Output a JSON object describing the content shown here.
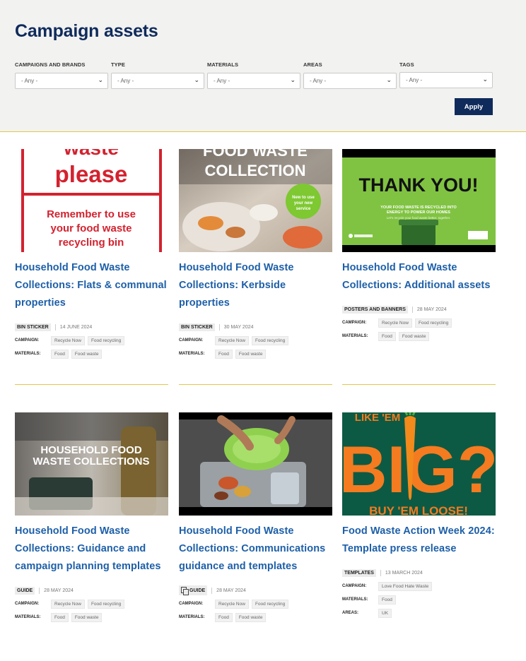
{
  "page": {
    "title": "Campaign assets"
  },
  "filters": [
    {
      "label": "Campaigns and brands",
      "value": "- Any -"
    },
    {
      "label": "Type",
      "value": "- Any -"
    },
    {
      "label": "Materials",
      "value": "- Any -"
    },
    {
      "label": "Areas",
      "value": "- Any -"
    },
    {
      "label": "Tags",
      "value": "- Any -"
    }
  ],
  "apply_label": "Apply",
  "colors": {
    "navy": "#0f2b5b",
    "link_blue": "#1d5fa8",
    "accent_yellow": "#e2c84a",
    "panel_grey": "#f2f2f1"
  },
  "cards": [
    {
      "title": "Household Food Waste Collections: Flats & communal properties",
      "type": "Bin sticker",
      "date": "14 June 2024",
      "campaign_label": "Campaign:",
      "materials_label": "Materials:",
      "campaign": [
        "Recycle Now",
        "Food recycling"
      ],
      "materials": [
        "Food",
        "Food waste"
      ],
      "image": {
        "line1": "waste",
        "line2": "please",
        "line3": "Remember to use",
        "line4": "your food waste",
        "line5": "recycling bin"
      }
    },
    {
      "title": "Household Food Waste Collections: Kerbside properties",
      "type": "Bin sticker",
      "date": "30 May 2024",
      "campaign_label": "Campaign:",
      "materials_label": "Materials:",
      "campaign": [
        "Recycle Now",
        "Food recycling"
      ],
      "materials": [
        "Food",
        "Food waste"
      ],
      "image": {
        "line1": "FOOD WASTE",
        "line2": "COLLECTION",
        "badge": "New to use your new service"
      }
    },
    {
      "title": "Household Food Waste Collections: Additional assets",
      "type": "Posters and banners",
      "date": "28 May 2024",
      "campaign_label": "Campaign:",
      "materials_label": "Materials:",
      "campaign": [
        "Recycle Now",
        "Food recycling"
      ],
      "materials": [
        "Food",
        "Food waste"
      ],
      "image": {
        "headline": "THANK YOU!",
        "sub1": "YOUR FOOD WASTE IS RECYCLED INTO",
        "sub2": "ENERGY TO POWER OUR HOMES",
        "sub3": "Let's recycle your food waste better, together."
      }
    },
    {
      "title": "Household Food Waste Collections: Guidance and campaign planning templates",
      "type": "Guide",
      "date": "28 May 2024",
      "campaign_label": "Campaign:",
      "materials_label": "Materials:",
      "campaign": [
        "Recycle Now",
        "Food recycling"
      ],
      "materials": [
        "Food",
        "Food waste"
      ],
      "image": {
        "line1": "HOUSEHOLD FOOD",
        "line2": "WASTE COLLECTIONS"
      }
    },
    {
      "title": "Household Food Waste Collections: Communications guidance and templates",
      "type": "Guide",
      "date": "28 May 2024",
      "campaign_label": "Campaign:",
      "materials_label": "Materials:",
      "campaign": [
        "Recycle Now",
        "Food recycling"
      ],
      "materials": [
        "Food",
        "Food waste"
      ]
    },
    {
      "title": "Food Waste Action Week 2024: Template press release",
      "type": "Templates",
      "date": "13 March 2024",
      "campaign_label": "Campaign:",
      "materials_label": "Materials:",
      "areas_label": "Areas:",
      "campaign": [
        "Love Food Hate Waste"
      ],
      "materials": [
        "Food"
      ],
      "areas": [
        "UK"
      ],
      "image": {
        "top": "LIKE 'EM",
        "big": "BIG?",
        "bottom": "BUY 'EM LOOSE!"
      }
    }
  ]
}
